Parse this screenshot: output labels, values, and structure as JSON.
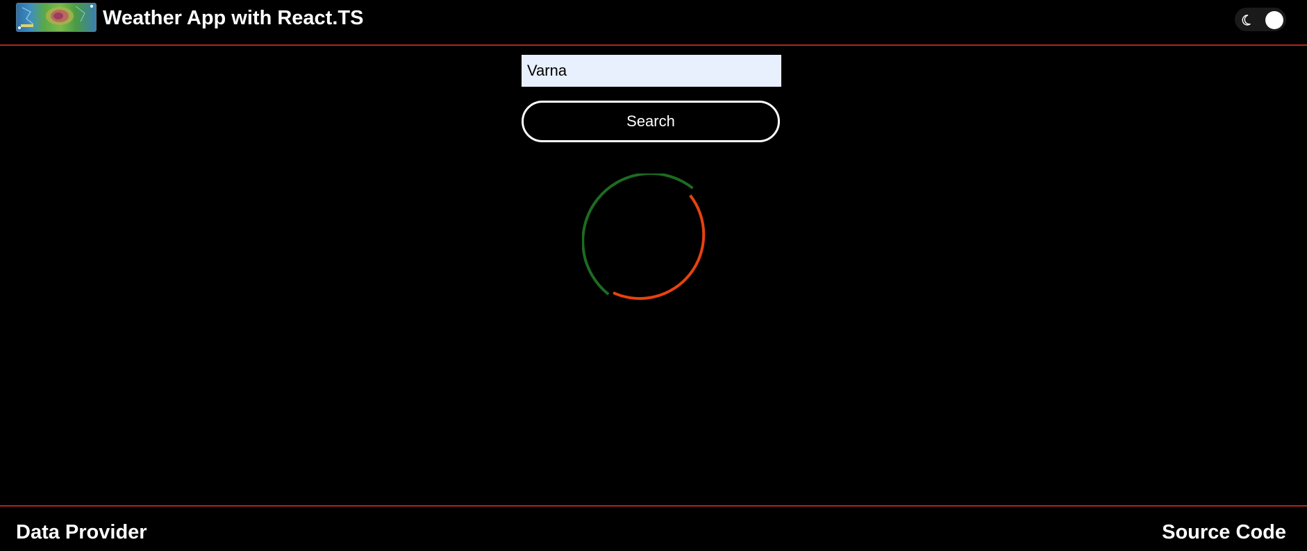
{
  "header": {
    "title": "Weather App with React.TS",
    "logo_icon": "weather-map-logo",
    "theme_toggle": {
      "icon": "moon-icon",
      "state": "dark"
    }
  },
  "search": {
    "value": "Varna",
    "button_label": "Search"
  },
  "loading": {
    "icon": "loading-spinner",
    "colors": {
      "primary": "#1d6b22",
      "secondary": "#e8420e"
    }
  },
  "footer": {
    "left_link": "Data Provider",
    "right_link": "Source Code"
  },
  "colors": {
    "background": "#000000",
    "divider": "#b3261e",
    "text": "#ffffff",
    "input_background": "#e8f0fe"
  }
}
